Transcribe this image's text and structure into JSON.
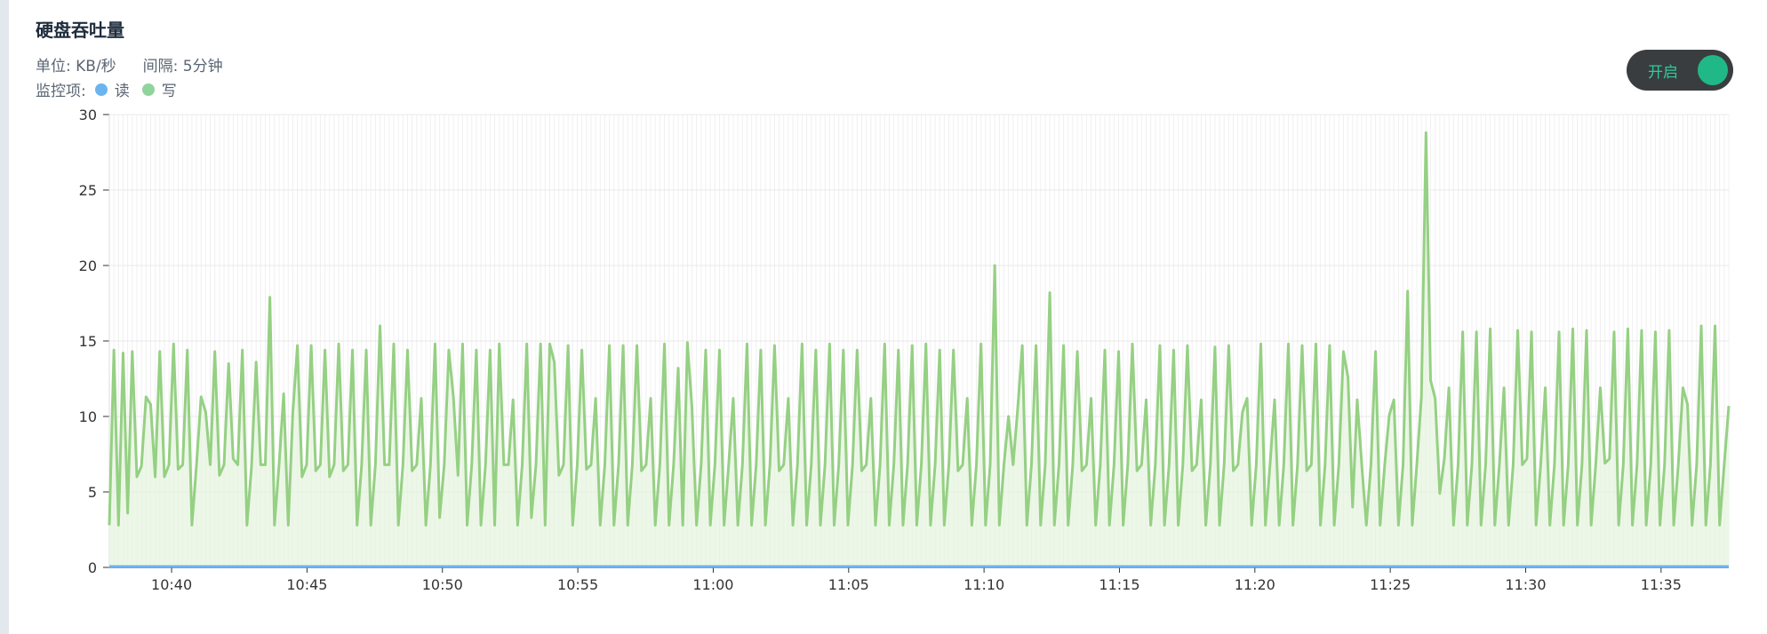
{
  "header": {
    "title": "硬盘吞吐量",
    "unit_label": "单位: KB/秒",
    "interval_label": "间隔: 5分钟",
    "monitor_label": "监控项:"
  },
  "legend": [
    {
      "name": "读",
      "color": "#6cb4ee"
    },
    {
      "name": "写",
      "color": "#8fd49a"
    }
  ],
  "toggle": {
    "label": "开启",
    "on": true
  },
  "colors": {
    "read": "#6cb4ee",
    "write": "#95d083",
    "write_fill": "#e6f3de",
    "grid": "#e8e8e8",
    "accent": "#20b886"
  },
  "chart_data": {
    "type": "line",
    "title": "硬盘吞吐量",
    "ylim": [
      0,
      30
    ],
    "yticks": [
      0,
      5,
      10,
      15,
      20,
      25,
      30
    ],
    "x_range_minutes": [
      637.7,
      697.5
    ],
    "xtick_labels": [
      "10:40",
      "10:45",
      "10:50",
      "10:55",
      "11:00",
      "11:05",
      "11:10",
      "11:15",
      "11:20",
      "11:25",
      "11:30",
      "11:35"
    ],
    "xtick_minutes": [
      640,
      645,
      650,
      655,
      660,
      665,
      670,
      675,
      680,
      685,
      690,
      695
    ],
    "series": [
      {
        "name": "读",
        "values": [
          0,
          0,
          0,
          0,
          0,
          0,
          0,
          0,
          0,
          0,
          0,
          0,
          0,
          0,
          0,
          0,
          0,
          0,
          0,
          0,
          0,
          0,
          0,
          0,
          0,
          0,
          0,
          0,
          0,
          0,
          0,
          0,
          0,
          0,
          0,
          0,
          0,
          0,
          0,
          0,
          0,
          0,
          0,
          0,
          0,
          0,
          0,
          0,
          0,
          0,
          0,
          0,
          0,
          0,
          0,
          0,
          0,
          0,
          0,
          0,
          0,
          0,
          0,
          0,
          0,
          0,
          0,
          0,
          0,
          0,
          0,
          0,
          0,
          0,
          0,
          0,
          0,
          0,
          0,
          0,
          0,
          0,
          0,
          0,
          0,
          0,
          0,
          0,
          0,
          0,
          0,
          0,
          0,
          0,
          0,
          0,
          0,
          0,
          0,
          0,
          0,
          0,
          0,
          0,
          0,
          0,
          0,
          0,
          0,
          0,
          0,
          0,
          0,
          0,
          0,
          0,
          0,
          0,
          0,
          0,
          0,
          0,
          0,
          0,
          0,
          0,
          0,
          0,
          0,
          0,
          0,
          0,
          0,
          0,
          0,
          0,
          0,
          0,
          0,
          0,
          0,
          0,
          0,
          0,
          0,
          0,
          0,
          0,
          0,
          0,
          0,
          0,
          0,
          0,
          0,
          0,
          0,
          0,
          0,
          0,
          0,
          0,
          0,
          0,
          0,
          0,
          0,
          0,
          0,
          0,
          0,
          0,
          0,
          0,
          0,
          0,
          0,
          0,
          0,
          0,
          0,
          0,
          0,
          0,
          0,
          0,
          0,
          0,
          0,
          0,
          0,
          0,
          0,
          0,
          0,
          0,
          0,
          0,
          0,
          0,
          0,
          0,
          0,
          0,
          0,
          0,
          0,
          0,
          0,
          0,
          0,
          0,
          0,
          0,
          0,
          0,
          0,
          0,
          0,
          0,
          0,
          0,
          0,
          0,
          0,
          0,
          0,
          0,
          0,
          0,
          0,
          0,
          0,
          0,
          0,
          0,
          0,
          0,
          0,
          0,
          0,
          0
        ]
      },
      {
        "name": "写",
        "values": [
          2.8,
          14.4,
          2.8,
          14.2,
          3.6,
          14.3,
          6,
          6.7,
          11.3,
          10.8,
          6,
          14.3,
          6,
          6.8,
          14.8,
          6.5,
          6.8,
          14.4,
          2.8,
          6.8,
          11.3,
          10.3,
          6.8,
          14.3,
          6.1,
          6.8,
          13.5,
          7.2,
          6.8,
          14.4,
          2.8,
          6.7,
          13.6,
          6.8,
          6.8,
          17.9,
          2.8,
          6.8,
          11.5,
          2.8,
          10.3,
          14.7,
          6,
          6.8,
          14.7,
          6.4,
          6.8,
          14.4,
          6,
          6.8,
          14.8,
          6.4,
          6.8,
          14.4,
          2.8,
          6.8,
          14.4,
          2.8,
          6.8,
          16,
          6.8,
          6.8,
          14.8,
          2.8,
          6.8,
          14.4,
          6.4,
          6.8,
          11.2,
          2.8,
          6.8,
          14.8,
          3.3,
          6.8,
          14.4,
          11.3,
          6.1,
          14.8,
          2.8,
          6.8,
          14.4,
          2.8,
          6.8,
          14.4,
          2.8,
          14.8,
          6.8,
          6.8,
          11.1,
          2.8,
          6.8,
          14.8,
          3.3,
          6.8,
          14.8,
          2.8,
          14.8,
          13.6,
          6.1,
          6.8,
          14.7,
          2.8,
          6.8,
          14.4,
          6.5,
          6.8,
          11.2,
          2.8,
          6.8,
          14.7,
          2.8,
          6.8,
          14.7,
          2.8,
          6.8,
          14.7,
          6.4,
          6.8,
          11.2,
          2.8,
          6.8,
          14.8,
          2.8,
          6.8,
          13.2,
          2.8,
          14.9,
          10.6,
          2.8,
          6.8,
          14.4,
          2.8,
          6.8,
          14.4,
          2.8,
          6.8,
          11.2,
          2.8,
          6.8,
          14.8,
          2.8,
          6.8,
          14.4,
          2.8,
          6.8,
          14.7,
          6.4,
          6.8,
          11.2,
          2.8,
          6.8,
          14.8,
          2.8,
          6.8,
          14.4,
          2.8,
          6.8,
          14.8,
          2.8,
          6.8,
          14.4,
          2.8,
          6.8,
          14.4,
          6.4,
          6.8,
          11.2,
          2.8,
          6.8,
          14.8,
          2.8,
          6.8,
          14.4,
          2.8,
          6.8,
          14.7,
          2.8,
          6.8,
          14.8,
          2.8,
          6.8,
          14.4,
          2.8,
          6.8,
          14.4,
          6.4,
          6.8,
          11.2,
          2.8,
          6.8,
          14.8,
          2.8,
          6.8,
          20,
          2.8,
          6.8,
          10,
          6.8,
          10.5,
          14.7,
          2.8,
          6.8,
          14.7,
          2.8,
          6.8,
          18.2,
          2.8,
          6.8,
          14.7,
          2.8,
          6.8,
          14.3,
          6.4,
          6.8,
          11.2,
          2.8,
          6.8,
          14.4,
          2.8,
          6.8,
          14.3,
          2.8,
          6.8,
          14.8,
          6.4,
          6.8,
          11.1,
          2.8,
          6.8,
          14.7,
          2.8,
          6.8,
          14.4,
          2.8,
          6.8,
          14.7,
          6.4,
          6.8,
          11.1,
          2.8,
          6.8,
          14.6,
          2.8,
          6.8,
          14.7,
          6.4,
          6.8,
          10.3,
          11.2,
          2.8,
          6.8,
          14.8,
          2.8,
          6.8,
          11.1,
          2.8,
          6.8,
          14.8,
          2.8,
          6.8,
          14.7,
          6.4,
          6.8,
          14.8,
          2.8,
          6.8,
          14.7,
          2.8,
          6.8,
          14.3,
          12.6,
          4,
          11.1,
          6.8,
          2.8,
          6.8,
          14.3,
          2.8,
          6.8,
          10.1,
          11.1,
          2.8,
          6.8,
          18.3,
          2.8,
          6.8,
          11.3,
          28.8,
          12.4,
          11.2,
          4.9,
          7.2,
          11.9,
          2.8,
          6.8,
          15.6,
          2.8,
          6.8,
          15.6,
          2.8,
          6.8,
          15.8,
          2.8,
          6.8,
          11.9,
          2.8,
          6.8,
          15.7,
          6.8,
          7.2,
          15.6,
          2.8,
          6.8,
          11.9,
          2.8,
          6.8,
          15.6,
          2.8,
          6.8,
          15.8,
          2.8,
          6.8,
          15.7,
          2.8,
          6.8,
          11.9,
          6.9,
          7.2,
          15.6,
          2.8,
          6.8,
          15.8,
          2.8,
          6.8,
          15.7,
          2.8,
          6.8,
          15.6,
          2.8,
          6.8,
          15.7,
          2.8,
          6.8,
          11.9,
          10.8,
          2.8,
          6.8,
          16,
          2.8,
          6.8,
          16,
          2.8,
          6.8,
          10.7
        ]
      }
    ]
  }
}
